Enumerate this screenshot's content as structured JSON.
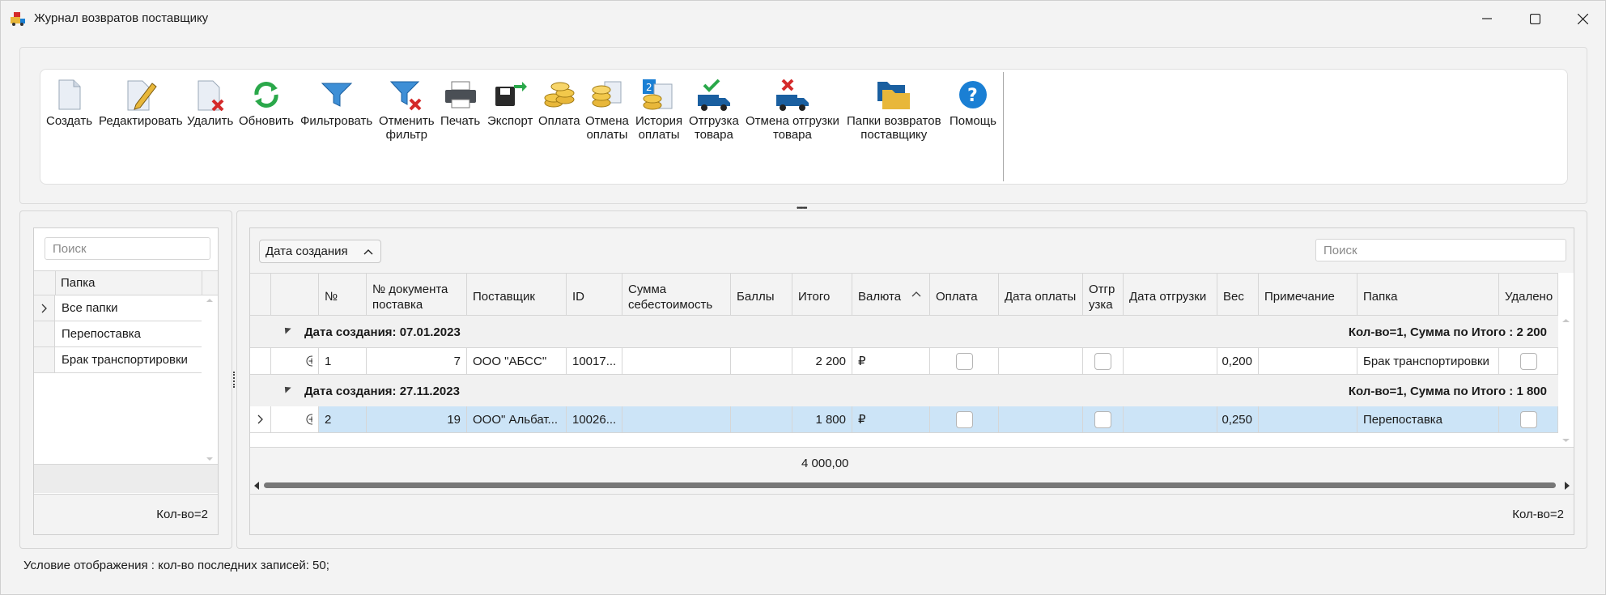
{
  "window": {
    "title": "Журнал возвратов поставщику",
    "minimize": "—",
    "maximize": "☐",
    "close": "✕"
  },
  "ribbon": {
    "buttons": [
      {
        "label": "Создать",
        "icon": "document-new-icon"
      },
      {
        "label": "Редактировать",
        "icon": "document-edit-icon"
      },
      {
        "label": "Удалить",
        "icon": "document-delete-icon"
      },
      {
        "label": "Обновить",
        "icon": "refresh-icon"
      },
      {
        "label": "Фильтровать",
        "icon": "filter-icon"
      },
      {
        "label_line1": "Отменить",
        "label_line2": "фильтр",
        "icon": "filter-clear-icon"
      },
      {
        "label": "Печать",
        "icon": "printer-icon"
      },
      {
        "label": "Экспорт",
        "icon": "export-icon"
      },
      {
        "label": "Оплата",
        "icon": "coins-icon"
      },
      {
        "label_line1": "Отмена",
        "label_line2": "оплаты",
        "icon": "coins-cancel-icon"
      },
      {
        "label_line1": "История",
        "label_line2": "оплаты",
        "icon": "payment-history-icon"
      },
      {
        "label_line1": "Отгрузка",
        "label_line2": "товара",
        "icon": "truck-check-icon"
      },
      {
        "label_line1": "Отмена отгрузки",
        "label_line2": "товара",
        "icon": "truck-cancel-icon"
      },
      {
        "label_line1": "Папки возвратов",
        "label_line2": "поставщику",
        "icon": "folders-icon"
      },
      {
        "label": "Помощь",
        "icon": "help-icon"
      }
    ],
    "colors": {
      "accent_blue": "#1a7fd4",
      "green": "#2aa84a",
      "red": "#d42a2a",
      "gold": "#e8b73a"
    }
  },
  "left_panel": {
    "search_placeholder": "Поиск",
    "column_header": "Папка",
    "folders": [
      "Все папки",
      "Перепоставка",
      "Брак транспортировки"
    ],
    "count": "Кол-во=2"
  },
  "main_panel": {
    "group_chip": "Дата создания",
    "search_placeholder": "Поиск",
    "columns": [
      "№",
      "№ документа поставка",
      "Поставщик",
      "ID",
      "Сумма себестоимость",
      "Баллы",
      "Итого",
      "Валюта",
      "Оплата",
      "Дата оплаты",
      "Отгр узка",
      "Дата отгрузки",
      "Вес",
      "Примечание",
      "Папка",
      "Удалено"
    ],
    "groups": [
      {
        "title": "Дата создания: 07.01.2023",
        "summary": "Кол-во=1,    Сумма по Итого :  2 200",
        "rows": [
          {
            "n": "1",
            "doc": "7",
            "supplier": "ООО \"АБСС\"",
            "id": "10017...",
            "cost": "",
            "points": "",
            "total": "2 200",
            "currency": "₽",
            "paid_date": "",
            "ship_date": "",
            "weight": "0,200",
            "note": "",
            "folder": "Брак транспортировки"
          }
        ]
      },
      {
        "title": "Дата создания: 27.11.2023",
        "summary": "Кол-во=1,    Сумма по Итого :  1 800",
        "rows": [
          {
            "n": "2",
            "doc": "19",
            "supplier": "ООО\" Альбат...",
            "id": "10026...",
            "cost": "",
            "points": "",
            "total": "1 800",
            "currency": "₽",
            "paid_date": "",
            "ship_date": "",
            "weight": "0,250",
            "note": "",
            "folder": "Перепоставка"
          }
        ]
      }
    ],
    "grand_total": "4 000,00",
    "count": "Кол-во=2",
    "selected_row_color": "#cce4f7"
  },
  "status": {
    "condition": "Условие отображения  :  кол-во последних записей: 50;"
  }
}
